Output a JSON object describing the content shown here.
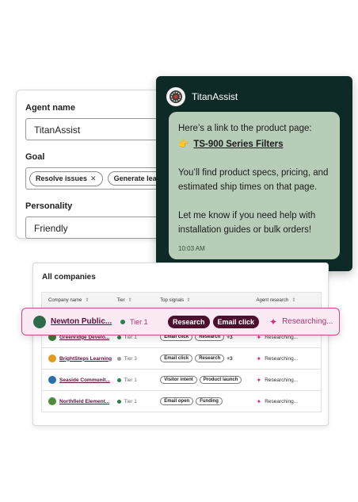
{
  "config": {
    "agent_name_label": "Agent name",
    "agent_name_value": "TitanAssist",
    "goal_label": "Goal",
    "goal_chips": [
      "Resolve issues",
      "Generate leads"
    ],
    "personality_label": "Personality",
    "personality_value": "Friendly"
  },
  "chat": {
    "agent_name": "TitanAssist",
    "intro": "Here’s a link to the product page:",
    "link_emoji": "👉",
    "link_text": "TS-900 Series Filters",
    "details": "You’ll find product specs, pricing, and estimated ship times on that page.",
    "followup": "Let me know if you need help with installation guides or bulk orders!",
    "time": "10:03 AM"
  },
  "companies": {
    "title": "All companies",
    "columns": [
      "Company name",
      "Tier",
      "Top signals",
      "Agent research"
    ],
    "highlight": {
      "name": "Newton Public...",
      "tier": "Tier 1",
      "signals": [
        "Research",
        "Email click"
      ],
      "status": "Researching..."
    },
    "rows": [
      {
        "name": "Greenridge Develo...",
        "tier": "Tier 1",
        "signals": [
          "Email click",
          "Research"
        ],
        "more": "+3",
        "status": "Researching...",
        "logo_color": "#3c7a3c",
        "dot_color": "#2e7d4f"
      },
      {
        "name": "BrightSteps Learning",
        "tier": "Tier 3",
        "signals": [
          "Email click",
          "Research"
        ],
        "more": "+3",
        "status": "Researching...",
        "logo_color": "#e39a1e",
        "dot_color": "#9a9a9a"
      },
      {
        "name": "Seaside Communit...",
        "tier": "Tier 1",
        "signals": [
          "Visitor intent",
          "Product launch"
        ],
        "more": "",
        "status": "Researching...",
        "logo_color": "#2a6fb0",
        "dot_color": "#2e7d4f"
      },
      {
        "name": "Northfield Element...",
        "tier": "Tier 1",
        "signals": [
          "Email open",
          "Funding"
        ],
        "more": "",
        "status": "Researching...",
        "logo_color": "#4f8a3a",
        "dot_color": "#2e7d4f"
      }
    ]
  },
  "colors": {
    "chat_bg": "#0e2a26",
    "bubble_bg": "#b7cdb7",
    "accent_pink": "#cc4b8e",
    "tag_dark": "#4d0f2e",
    "tier1_dot": "#2e7d4f"
  },
  "icons": {
    "sort": "sort-updown-icon",
    "research": "sparkle-icon",
    "chip_remove": "close-icon",
    "avatar": "gear-emblem-icon"
  }
}
